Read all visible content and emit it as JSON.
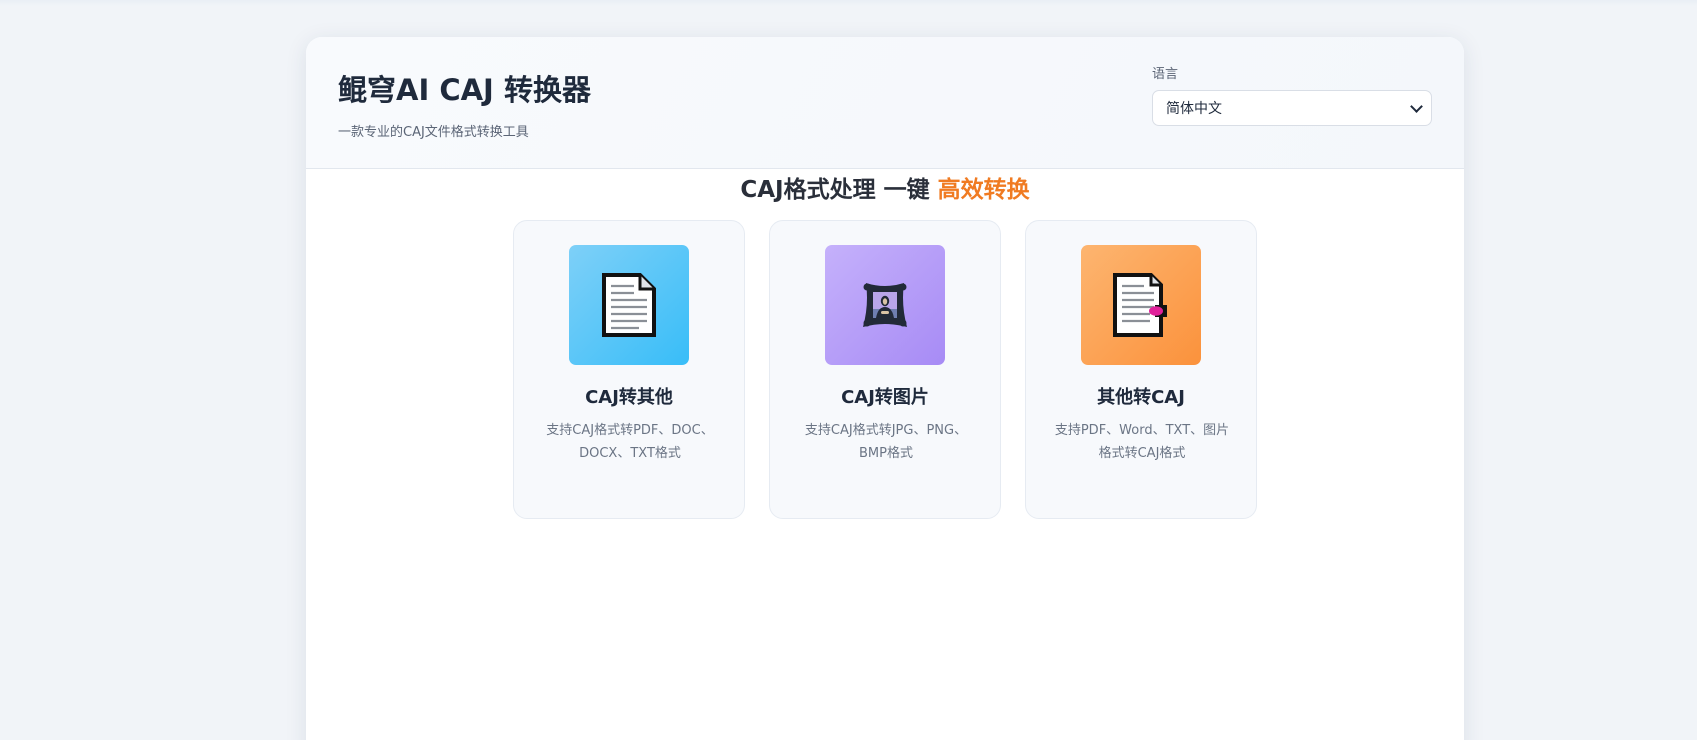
{
  "app": {
    "title": "鲲穹AI CAJ 转换器",
    "subtitle": "一款专业的CAJ文件格式转换工具"
  },
  "language": {
    "label": "语言",
    "selected": "简体中文"
  },
  "hero": {
    "text": "CAJ格式处理  一键 ",
    "accent": "高效转换",
    "accent_color": "#f07b22"
  },
  "cards": [
    {
      "title": "CAJ转其他",
      "description": "支持CAJ格式转PDF、DOC、DOCX、TXT格式",
      "icon": "document-icon",
      "color": "#38bdf8"
    },
    {
      "title": "CAJ转图片",
      "description": "支持CAJ格式转JPG、PNG、BMP格式",
      "icon": "framed-picture-icon",
      "color": "#a78bf5"
    },
    {
      "title": "其他转CAJ",
      "description": "支持PDF、Word、TXT、图片格式转CAJ格式",
      "icon": "bookmarked-document-icon",
      "color": "#fb923c"
    }
  ]
}
